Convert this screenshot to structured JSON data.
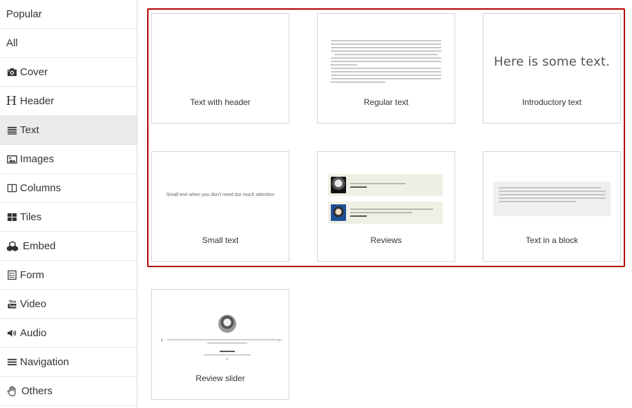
{
  "sidebar": {
    "items": [
      {
        "label": "Popular",
        "icon": "none"
      },
      {
        "label": "All",
        "icon": "none"
      },
      {
        "label": "Cover",
        "icon": "camera-icon"
      },
      {
        "label": "Header",
        "icon": "header-icon"
      },
      {
        "label": "Text",
        "icon": "text-lines-icon",
        "active": true
      },
      {
        "label": "Images",
        "icon": "image-icon"
      },
      {
        "label": "Columns",
        "icon": "columns-icon"
      },
      {
        "label": "Tiles",
        "icon": "tiles-icon"
      },
      {
        "label": "Embed",
        "icon": "cubes-icon"
      },
      {
        "label": "Form",
        "icon": "form-icon"
      },
      {
        "label": "Video",
        "icon": "youtube-icon"
      },
      {
        "label": "Audio",
        "icon": "volume-icon"
      },
      {
        "label": "Navigation",
        "icon": "menu-icon"
      },
      {
        "label": "Others",
        "icon": "hand-icon"
      }
    ]
  },
  "blocks": {
    "text_with_header": {
      "label": "Text with header"
    },
    "regular_text": {
      "label": "Regular text"
    },
    "introductory_text": {
      "label": "Introductory text",
      "preview": "Here is some text."
    },
    "small_text": {
      "label": "Small text",
      "preview": "Small text when you don't need too much attention"
    },
    "reviews": {
      "label": "Reviews"
    },
    "text_in_block": {
      "label": "Text in a block"
    },
    "review_slider": {
      "label": "Review slider"
    }
  },
  "colors": {
    "selection_border": "#b30000",
    "active_item_bg": "#ebebeb"
  }
}
